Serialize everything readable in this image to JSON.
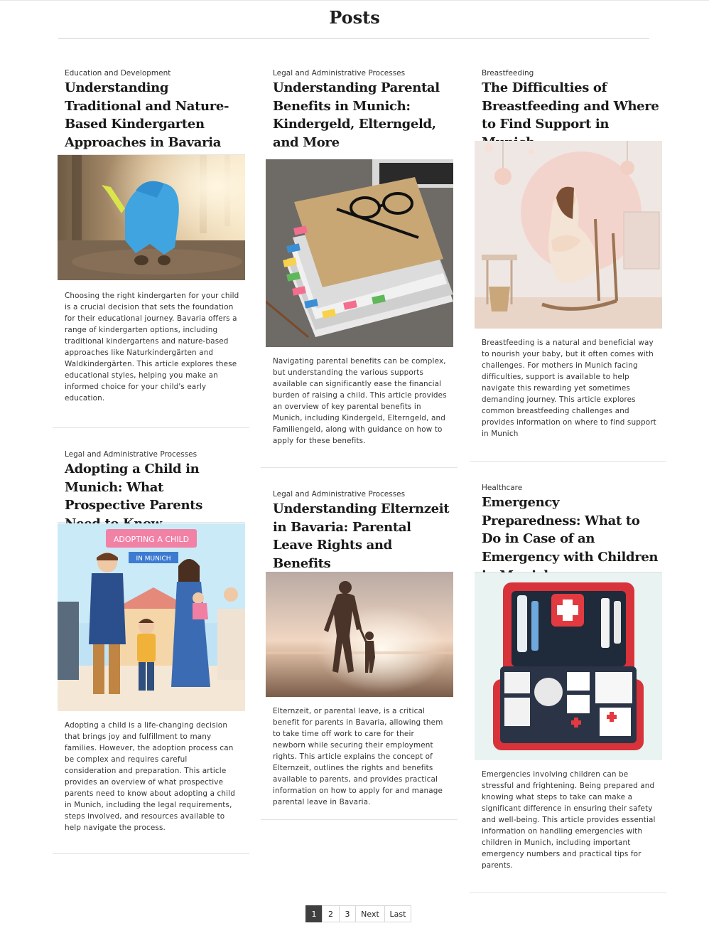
{
  "page": {
    "title": "Posts"
  },
  "posts": [
    {
      "category": "Education and Development",
      "title": "Understanding Traditional and Nature-Based Kindergarten Approaches in Bavaria",
      "image_alt": "child in blue rain suit playing in forest",
      "excerpt": "Choosing the right kindergarten for your child is a crucial decision that sets the foundation for their educational journey. Bavaria offers a range of kindergarten options, including traditional kindergartens and nature-based approaches like Naturkindergärten and Waldkindergärten. This article explores these educational styles, helping you make an informed choice for your child's early education."
    },
    {
      "category": "Legal and Administrative Processes",
      "title": "Understanding Parental Benefits in Munich: Kindergeld, Elterngeld, and More",
      "image_alt": "stack of folders with colorful tabs and glasses",
      "excerpt": "Navigating parental benefits can be complex, but understanding the various supports available can significantly ease the financial burden of raising a child. This article provides an overview of key parental benefits in Munich, including Kindergeld, Elterngeld, and Familiengeld, along with guidance on how to apply for these benefits."
    },
    {
      "category": "Breastfeeding",
      "title": "The Difficulties of Breastfeeding and Where to Find Support in Munich",
      "image_alt": "mother breastfeeding in a rocking chair",
      "excerpt": "Breastfeeding is a natural and beneficial way to nourish your baby, but it often comes with challenges. For mothers in Munich facing difficulties, support is available to help navigate this rewarding yet sometimes demanding journey. This article explores common breastfeeding challenges and provides information on where to find support in Munich"
    },
    {
      "category": "Legal and Administrative Processes",
      "title": "Adopting a Child in Munich: What Prospective Parents Need to Know",
      "image_alt": "cartoon family adopting a child",
      "sign_line1": "ADOPTING A CHILD",
      "sign_line2": "IN MUNICH",
      "excerpt": "Adopting a child is a life-changing decision that brings joy and fulfillment to many families. However, the adoption process can be complex and requires careful consideration and preparation. This article provides an overview of what prospective parents need to know about adopting a child in Munich, including the legal requirements, steps involved, and resources available to help navigate the process."
    },
    {
      "category": "Legal and Administrative Processes",
      "title": "Understanding Elternzeit in Bavaria: Parental Leave Rights and Benefits",
      "image_alt": "parent and child walking on beach at sunset",
      "excerpt": "Elternzeit, or parental leave, is a critical benefit for parents in Bavaria, allowing them to take time off work to care for their newborn while securing their employment rights. This article explains the concept of Elternzeit, outlines the rights and benefits available to parents, and provides practical information on how to apply for and manage parental leave in Bavaria."
    },
    {
      "category": "Healthcare",
      "title": "Emergency Preparedness: What to Do in Case of an Emergency with Children in Munich",
      "image_alt": "open red first aid kit",
      "excerpt": "Emergencies involving children can be stressful and frightening. Being prepared and knowing what steps to take can make a significant difference in ensuring their safety and well-being. This article provides essential information on handling emergencies with children in Munich, including important emergency numbers and practical tips for parents."
    }
  ],
  "pagination": {
    "pages": [
      "1",
      "2",
      "3"
    ],
    "current": "1",
    "next": "Next",
    "last": "Last"
  }
}
